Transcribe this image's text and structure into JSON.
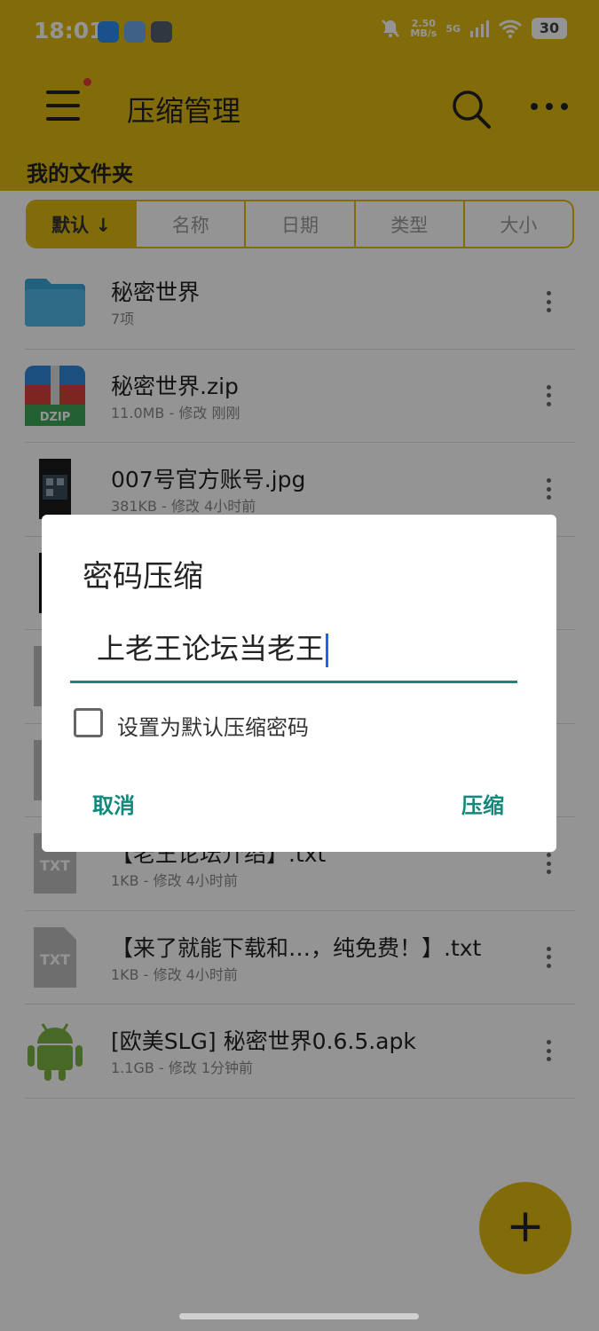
{
  "status_bar": {
    "time": "18:01",
    "speed_value": "2.50",
    "speed_unit": "MB/s",
    "network": "5G",
    "battery": "30"
  },
  "toolbar": {
    "title": "压缩管理"
  },
  "folder_title": "我的文件夹",
  "sort_tabs": [
    "默认 ↓",
    "名称",
    "日期",
    "类型",
    "大小"
  ],
  "files": [
    {
      "name": "秘密世界",
      "meta": "7项",
      "icon": "folder-icon"
    },
    {
      "name": "秘密世界.zip",
      "meta": "11.0MB - 修改 刚刚",
      "icon": "zip-icon"
    },
    {
      "name": "007号官方账号.jpg",
      "meta": "381KB - 修改 4小时前",
      "icon": "image-icon"
    },
    {
      "name": "",
      "meta": "",
      "icon": "image-icon"
    },
    {
      "name": "",
      "meta": "",
      "icon": "file-icon"
    },
    {
      "name": "",
      "meta": "",
      "icon": "file-icon"
    },
    {
      "name": "【老王论坛介绍】.txt",
      "meta": "1KB - 修改 4小时前",
      "icon": "txt-icon"
    },
    {
      "name": "【来了就能下载和…，纯免费！】.txt",
      "meta": "1KB - 修改 4小时前",
      "icon": "txt-icon"
    },
    {
      "name": "[欧美SLG] 秘密世界0.6.5.apk",
      "meta": "1.1GB - 修改 1分钟前",
      "icon": "android-icon"
    }
  ],
  "dialog": {
    "title": "密码压缩",
    "password_value": "上老王论坛当老王",
    "checkbox_label": "设置为默认压缩密码",
    "checkbox_checked": false,
    "cancel_label": "取消",
    "confirm_label": "压缩"
  },
  "fab_label": "+",
  "colors": {
    "accent": "#E0BA12",
    "dialog_accent": "#12897c"
  }
}
